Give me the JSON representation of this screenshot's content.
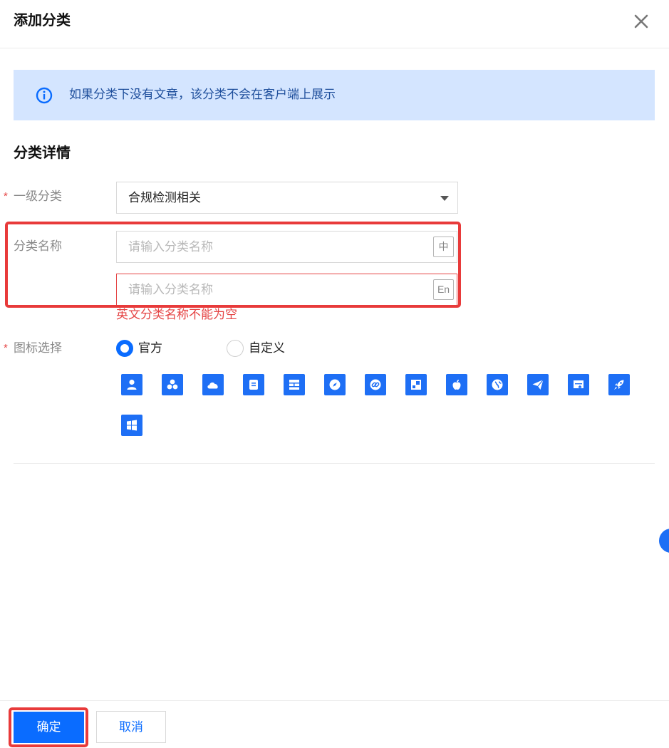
{
  "dialog": {
    "title": "添加分类",
    "close_icon": "close-icon"
  },
  "alert": {
    "icon": "info-icon",
    "text": "如果分类下没有文章，该分类不会在客户端上展示",
    "color": "#d4e5ff"
  },
  "section": {
    "title": "分类详情"
  },
  "form": {
    "required_mark": "*",
    "level1": {
      "label": "一级分类",
      "value": "合规检测相关"
    },
    "name": {
      "label": "分类名称",
      "zh_placeholder": "请输入分类名称",
      "zh_value": "",
      "zh_lang": "中",
      "en_placeholder": "请输入分类名称",
      "en_value": "",
      "en_lang": "En",
      "error": "英文分类名称不能为空"
    },
    "icon": {
      "label": "图标选择",
      "options": [
        "官方",
        "自定义"
      ],
      "selected": "官方",
      "icons": [
        "user-icon",
        "group-icon",
        "cloud-icon",
        "document-icon",
        "layout-icon",
        "compass-icon",
        "link-icon",
        "split-icon",
        "apple-icon",
        "globe-icon",
        "paper-plane-icon",
        "monitor-upload-icon",
        "rocket-icon",
        "windows-icon"
      ]
    }
  },
  "footer": {
    "ok_label": "确定",
    "cancel_label": "取消"
  },
  "colors": {
    "primary": "#0a6cff",
    "error": "#e54545",
    "highlight_frame": "#e83a3a",
    "icon_bg": "#1e6ff5"
  }
}
